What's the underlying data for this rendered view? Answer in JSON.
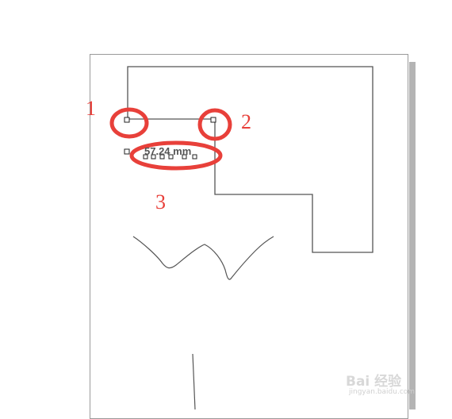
{
  "canvas": {
    "dimension_label": "57.24 mm"
  },
  "callouts": [
    {
      "number": "1"
    },
    {
      "number": "2"
    },
    {
      "number": "3"
    }
  ],
  "watermark": {
    "brand": "Bai 经验",
    "url": "jingyan.baidu.com"
  },
  "colors": {
    "callout": "#e8403a",
    "outline": "#555555",
    "page_border": "#9a9a9a",
    "page_shadow": "#b4b4b4"
  }
}
